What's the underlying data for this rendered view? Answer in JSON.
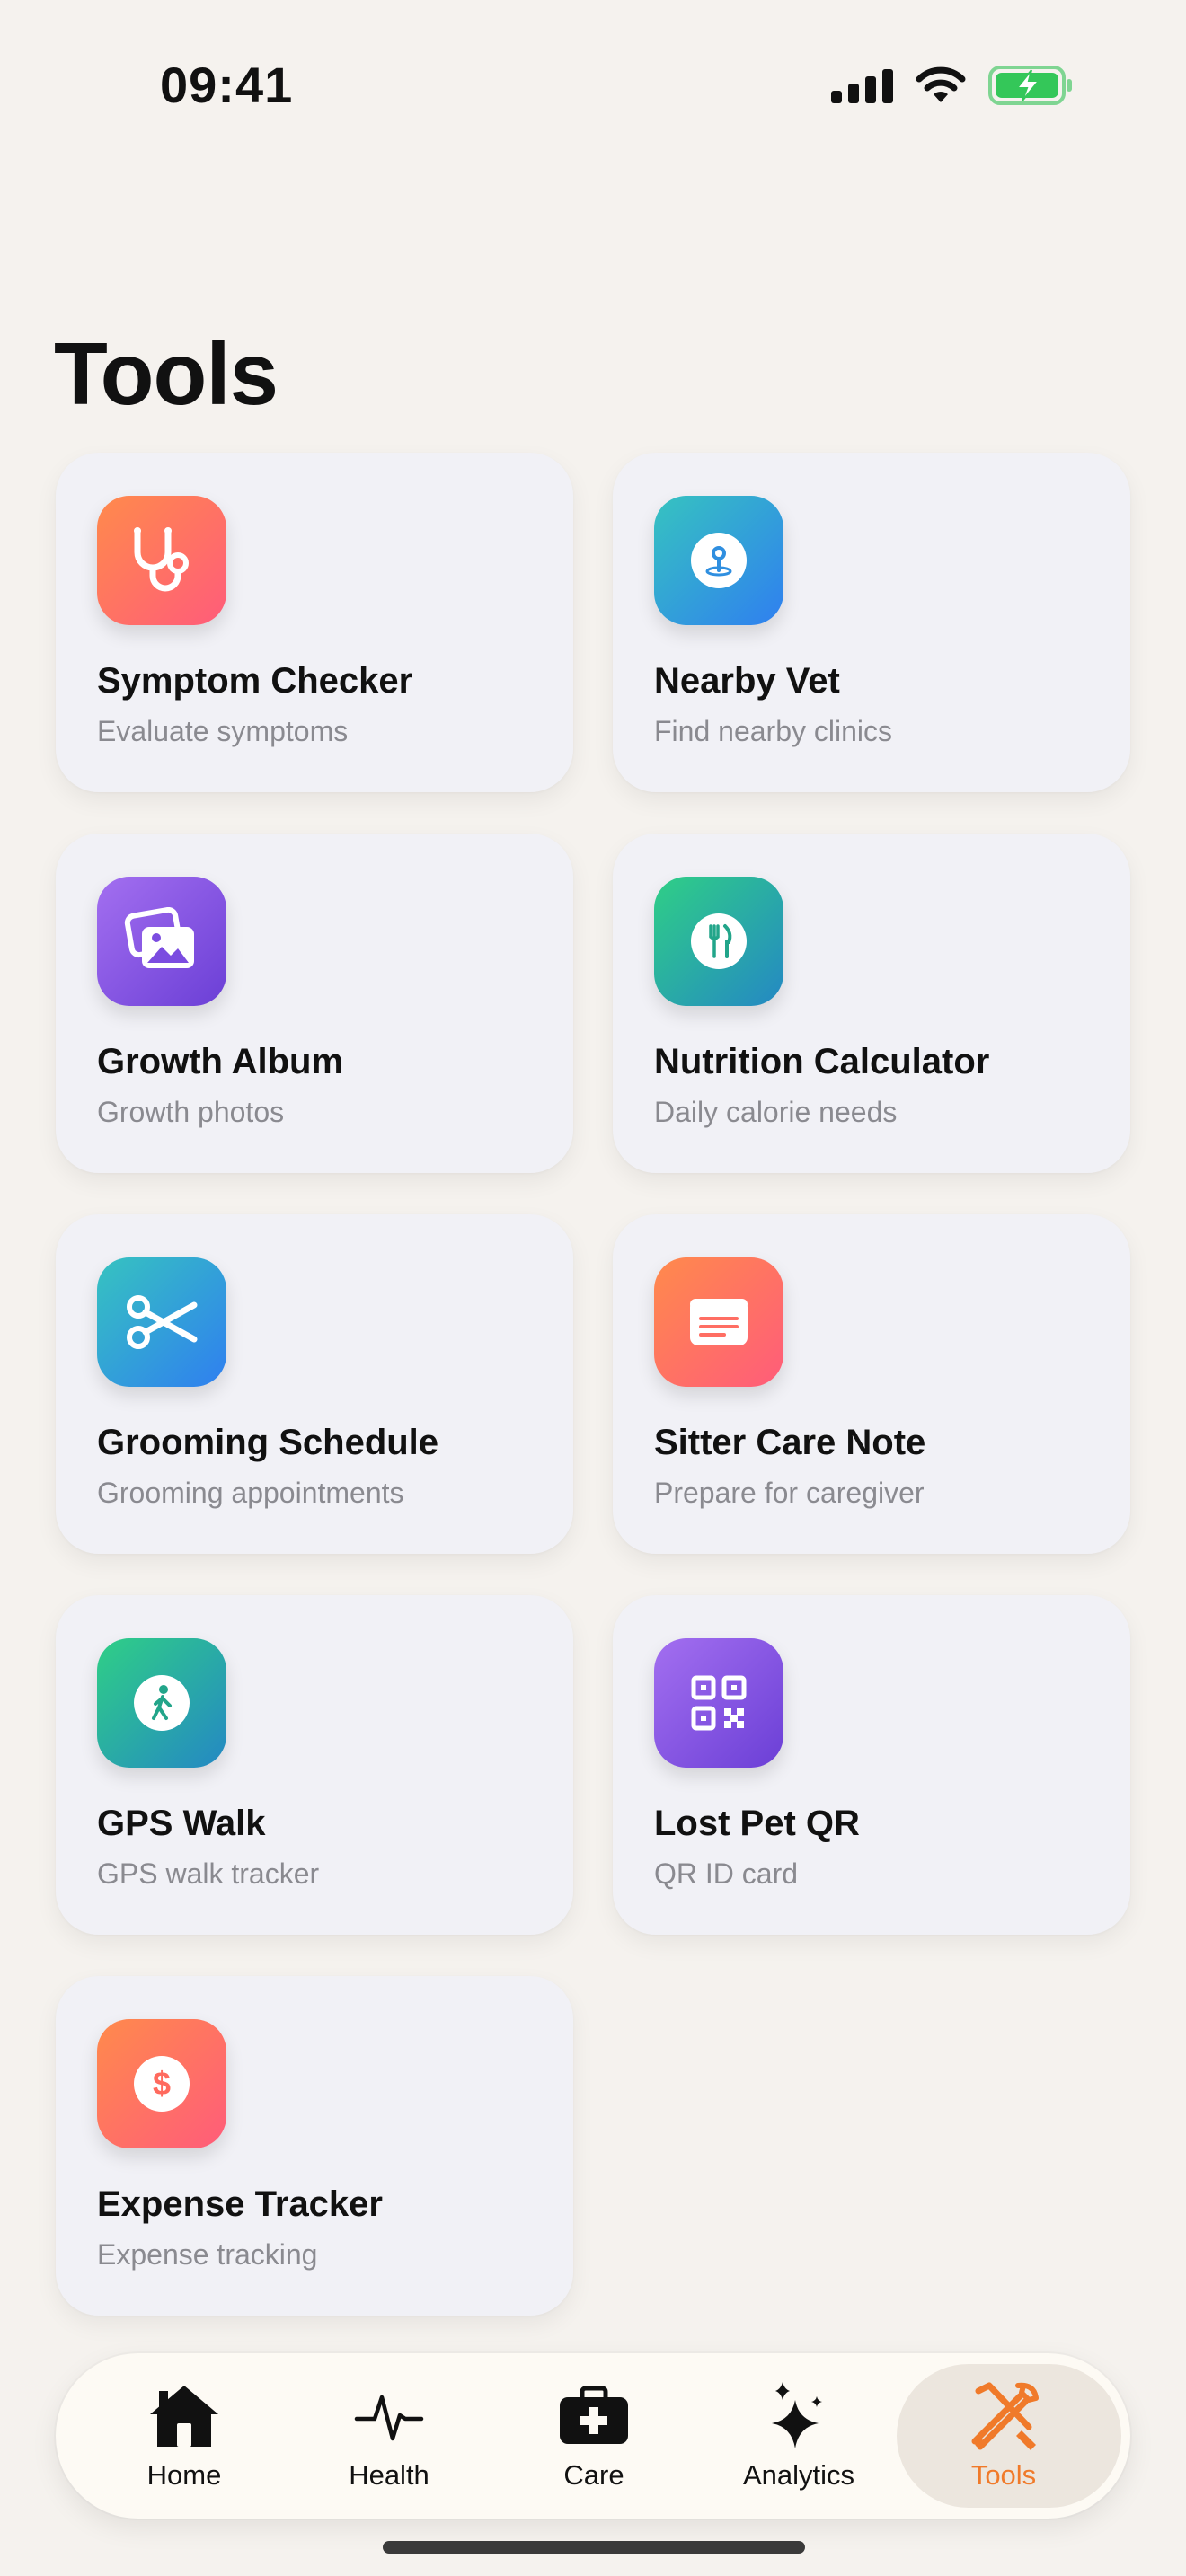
{
  "status_bar": {
    "time": "09:41"
  },
  "page": {
    "title": "Tools"
  },
  "tools": [
    {
      "title": "Symptom Checker",
      "subtitle": "Evaluate symptoms",
      "icon": "stethoscope-icon",
      "color": "orange"
    },
    {
      "title": "Nearby Vet",
      "subtitle": "Find nearby clinics",
      "icon": "location-pin-icon",
      "color": "blue"
    },
    {
      "title": "Growth Album",
      "subtitle": "Growth photos",
      "icon": "photo-album-icon",
      "color": "purple"
    },
    {
      "title": "Nutrition Calculator",
      "subtitle": "Daily calorie needs",
      "icon": "fork-knife-icon",
      "color": "green"
    },
    {
      "title": "Grooming Schedule",
      "subtitle": "Grooming appointments",
      "icon": "scissors-icon",
      "color": "blue"
    },
    {
      "title": "Sitter Care Note",
      "subtitle": "Prepare for caregiver",
      "icon": "note-card-icon",
      "color": "orange"
    },
    {
      "title": "GPS Walk",
      "subtitle": "GPS walk tracker",
      "icon": "walking-person-icon",
      "color": "green"
    },
    {
      "title": "Lost Pet QR",
      "subtitle": "QR ID card",
      "icon": "qr-code-icon",
      "color": "purple"
    },
    {
      "title": "Expense Tracker",
      "subtitle": "Expense tracking",
      "icon": "dollar-icon",
      "color": "orange"
    }
  ],
  "tab_bar": {
    "tabs": [
      {
        "label": "Home",
        "icon": "house-icon",
        "active": false
      },
      {
        "label": "Health",
        "icon": "heartbeat-icon",
        "active": false
      },
      {
        "label": "Care",
        "icon": "medical-kit-icon",
        "active": false
      },
      {
        "label": "Analytics",
        "icon": "sparkles-icon",
        "active": false
      },
      {
        "label": "Tools",
        "icon": "tools-icon",
        "active": true
      }
    ]
  },
  "colors": {
    "background": "#f5f2ee",
    "card": "#f1f1f6",
    "accent": "#f07a2a",
    "subtitle": "#8a8a90",
    "battery": "#34c759"
  }
}
